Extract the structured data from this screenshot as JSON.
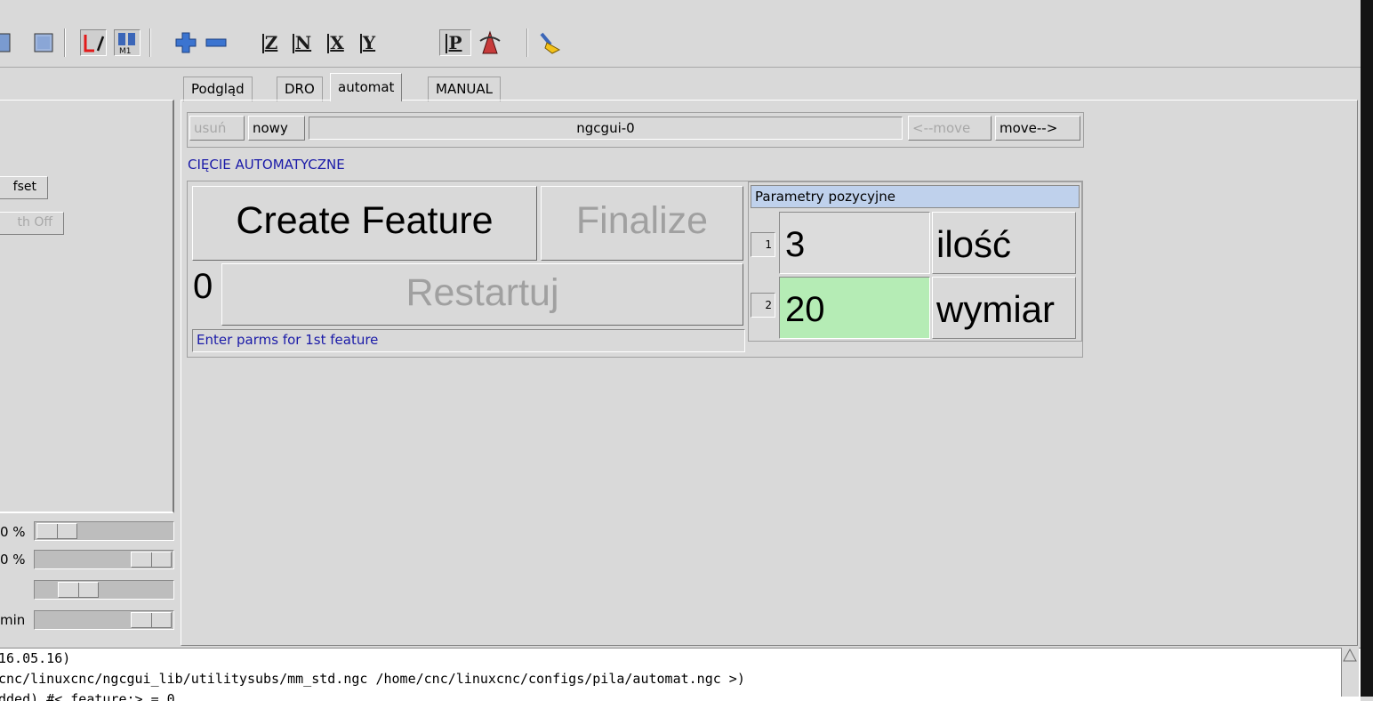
{
  "tabs": [
    {
      "label": "Podgląd"
    },
    {
      "label": "DRO"
    },
    {
      "label": "automat",
      "active": true
    },
    {
      "label": "MANUAL"
    }
  ],
  "toolbar": {
    "icons": [
      "view-outline-icon",
      "view-solid-icon",
      "tool-path-icon",
      "m1-pause-icon",
      "zoom-in-icon",
      "zoom-out-icon",
      "view-z-icon",
      "view-rotated-z-icon",
      "view-x-icon",
      "view-y-icon",
      "view-p-icon",
      "rotate-view-icon",
      "clear-plot-icon"
    ],
    "axis_z": "Z",
    "axis_x": "X",
    "axis_y": "Y",
    "axis_p": "P",
    "axis_n": "N",
    "m1_label": "M1"
  },
  "left_panel": {
    "offset_btn": "fset",
    "touch_off_btn": "th Off",
    "sliders": [
      {
        "label": "0 %",
        "position": 0.05
      },
      {
        "label": "0 %",
        "position": 0.75
      },
      {
        "label": "",
        "position": 0.18
      },
      {
        "label": "min",
        "position": 0.75
      }
    ]
  },
  "ngcgui": {
    "delete_btn": "usuń",
    "new_btn": "nowy",
    "page_name": "ngcgui-0",
    "move_left_btn": "<--move",
    "move_right_btn": "move-->",
    "section_title": "CIĘCIE AUTOMATYCZNE",
    "create_btn": "Create Feature",
    "finalize_btn": "Finalize",
    "counter": "0",
    "restart_btn": "Restartuj",
    "status": "Enter parms for 1st feature",
    "params_title": "Parametry pozycyjne",
    "params": [
      {
        "num": "1",
        "value": "3",
        "label": "ilość",
        "color": "#dcdcdc"
      },
      {
        "num": "2",
        "value": "20",
        "label": "wymiar",
        "color": "#b5ecb5"
      }
    ]
  },
  "console": {
    "lines": [
      "16.05.16)",
      "cnc/linuxcnc/ngcgui_lib/utilitysubs/mm_std.ngc /home/cnc/linuxcnc/configs/pila/automat.ngc >)",
      "dded) #<_feature:> = 0"
    ]
  },
  "colors": {
    "accent_blue_text": "#1a1aa8",
    "params_header": "#bfd1ec",
    "active_field": "#b5ecb5"
  }
}
